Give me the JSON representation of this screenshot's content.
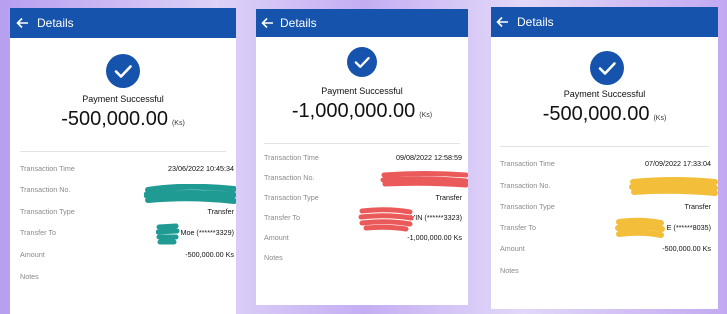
{
  "colors": {
    "header_bg": "#1553ad",
    "check_bg": "#1553ad",
    "redact_teal": "#1f9b94",
    "redact_red": "#ea5a5a",
    "redact_yellow": "#f3bf3a"
  },
  "icons": {
    "back": "arrow-left-icon",
    "success": "check-circle-icon"
  },
  "screens": [
    {
      "header_title": "Details",
      "status": "Payment Successful",
      "amount": "-500,000.00",
      "currency": "(Ks)",
      "rows": {
        "time_label": "Transaction Time",
        "time_value": "23/06/2022 10:45:34",
        "no_label": "Transaction No.",
        "type_label": "Transaction Type",
        "type_value": "Transfer",
        "to_label": "Transfer To",
        "to_value": "Moe (******3329)",
        "amount_label": "Amount",
        "amount_value": "-500,000.00 Ks",
        "notes_label": "Notes"
      }
    },
    {
      "header_title": "Details",
      "status": "Payment Successful",
      "amount": "-1,000,000.00",
      "currency": "(Ks)",
      "rows": {
        "time_label": "Transaction Time",
        "time_value": "09/08/2022 12:58:59",
        "no_label": "Transaction No.",
        "type_label": "Transaction Type",
        "type_value": "Transfer",
        "to_label": "Transfer To",
        "to_value": "YIN (******3323)",
        "amount_label": "Amount",
        "amount_value": "-1,000,000.00 Ks",
        "notes_label": "Notes"
      }
    },
    {
      "header_title": "Details",
      "status": "Payment Successful",
      "amount": "-500,000.00",
      "currency": "(Ks)",
      "rows": {
        "time_label": "Transaction Time",
        "time_value": "07/09/2022 17:33:04",
        "no_label": "Transaction No.",
        "type_label": "Transaction Type",
        "type_value": "Transfer",
        "to_label": "Transfer To",
        "to_value": "E (******8035)",
        "amount_label": "Amount",
        "amount_value": "-500,000.00 Ks",
        "notes_label": "Notes"
      }
    }
  ]
}
